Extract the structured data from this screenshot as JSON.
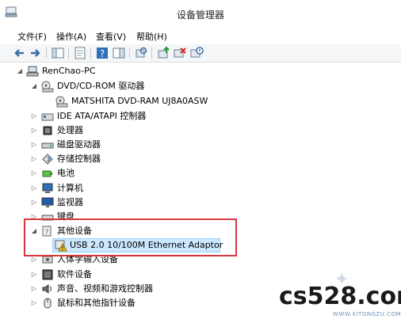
{
  "window": {
    "title": "设备管理器"
  },
  "menu": [
    "文件(F)",
    "操作(A)",
    "查看(V)",
    "帮助(H)"
  ],
  "toolbar": {
    "buttons": [
      "back-icon",
      "forward-icon",
      "show-hide-tree-icon",
      "properties-icon",
      "help-icon",
      "action-pane-icon",
      "scan-hardware-icon",
      "update-driver-icon",
      "uninstall-icon",
      "disable-icon"
    ]
  },
  "tree": {
    "root": "RenChao-PC",
    "dvd": "DVD/CD-ROM 驱动器",
    "dvd_child": "MATSHITA DVD-RAM UJ8A0ASW",
    "ide": "IDE ATA/ATAPI 控制器",
    "cpu": "处理器",
    "disk": "磁盘驱动器",
    "storage": "存储控制器",
    "battery": "电池",
    "computer": "计算机",
    "monitor": "监视器",
    "keyboard": "键盘",
    "other": "其他设备",
    "other_child": "USB 2.0 10/100M Ethernet Adaptor",
    "hid": "人体学输入设备",
    "software": "软件设备",
    "audio": "声音、视频和游戏控制器",
    "mouse": "鼠标和其他指针设备"
  },
  "watermark": {
    "text": "cs528.com",
    "sub": "WWW.XITONGZU.COM"
  },
  "colors": {
    "selection": "#cce8ff",
    "highlight_border": "#d9363e"
  }
}
